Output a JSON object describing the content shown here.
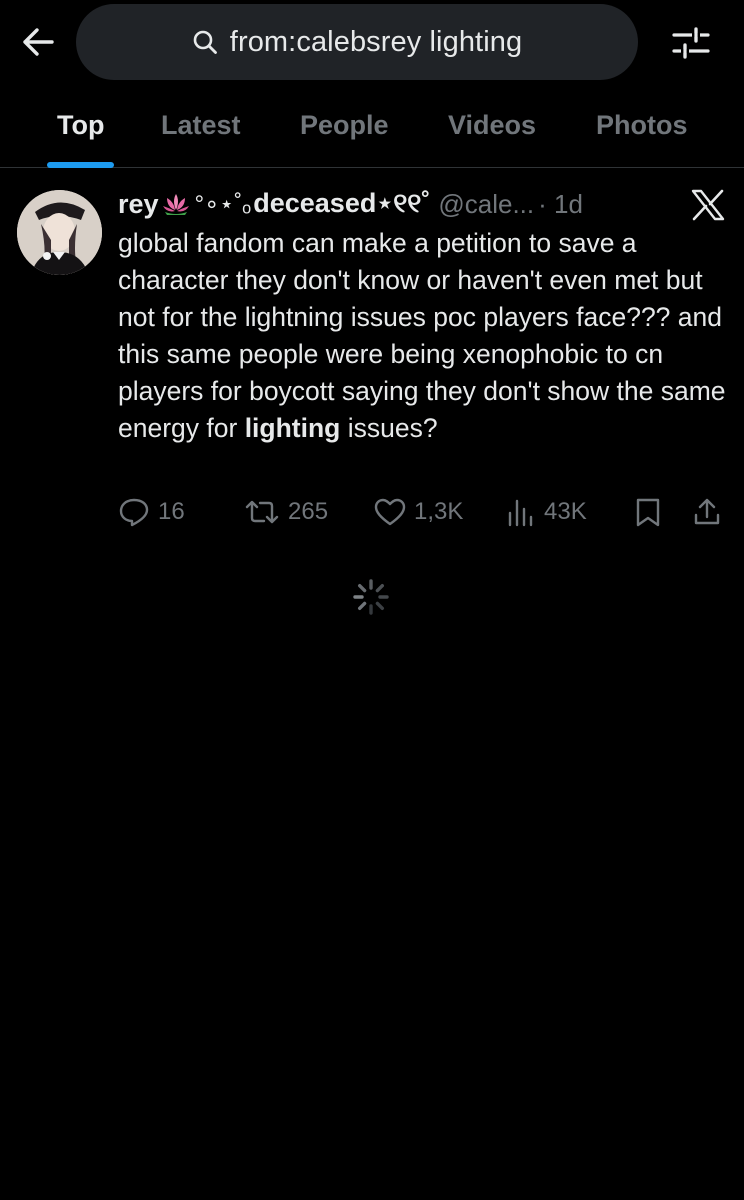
{
  "search": {
    "query": "from:calebsrey lighting"
  },
  "tabs": [
    {
      "label": "Top",
      "active": true
    },
    {
      "label": "Latest",
      "active": false
    },
    {
      "label": "People",
      "active": false
    },
    {
      "label": "Videos",
      "active": false
    },
    {
      "label": "Photos",
      "active": false
    }
  ],
  "tweet": {
    "display_name": "rey",
    "name_decoration": "°∘⋆˚ₒ",
    "name_suffix": "deceased⋆୧୧˚",
    "handle": "@cale...",
    "time": "· 1d",
    "text_main": "global fandom can make a petition to save a character they don't know or haven't even met but not for the lightning issues poc players face??? and this same people were being xenophobic to cn players for boycott saying they don't show the same energy for ",
    "text_bold": "lighting",
    "text_end": " issues?",
    "replies": "16",
    "reposts": "265",
    "likes": "1,3K",
    "views": "43K"
  },
  "colors": {
    "background": "#000000",
    "accent": "#1d9bf0",
    "muted": "#71767b",
    "text": "#e7e9ea",
    "search_bg": "#202327"
  },
  "icons": [
    "back-arrow-icon",
    "search-icon",
    "filter-icon",
    "x-logo-icon",
    "reply-icon",
    "repost-icon",
    "like-icon",
    "views-icon",
    "bookmark-icon",
    "share-icon",
    "loading-spinner-icon"
  ]
}
